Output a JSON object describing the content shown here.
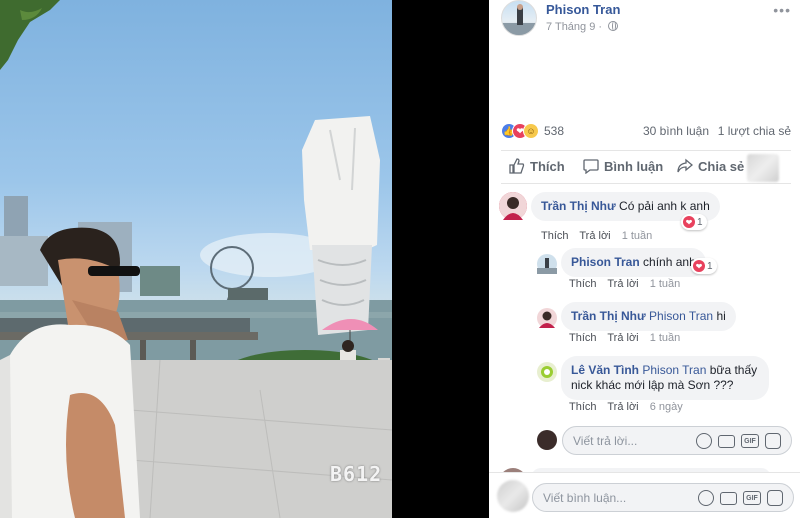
{
  "post": {
    "author": "Phison Tran",
    "date": "7 Tháng 9",
    "reaction_count": "538",
    "comments_count": "30 bình luận",
    "shares_count": "1 lượt chia sẻ",
    "photo_watermark": "B612"
  },
  "actions": {
    "like": "Thích",
    "comment": "Bình luận",
    "share": "Chia sẻ"
  },
  "comments": [
    {
      "name": "Trần Thị Như",
      "text": "Có pải anh k anh",
      "like": "Thích",
      "reply": "Trả lời",
      "time": "1 tuần",
      "reactions": "1"
    },
    {
      "name": "Phison Tran",
      "text": "chính anh",
      "like": "Thích",
      "reply": "Trả lời",
      "time": "1 tuần",
      "reactions": "1"
    },
    {
      "name": "Trần Thị Như",
      "tag": "Phison Tran",
      "text": "hi",
      "like": "Thích",
      "reply": "Trả lời",
      "time": "1 tuần"
    },
    {
      "name": "Lê Văn Tình",
      "tag": "Phison Tran",
      "text": "bữa thấy",
      "text2": "nick khác mới lập mà Sơn ???",
      "like": "Thích",
      "reply": "Trả lời",
      "time": "6 ngày"
    }
  ],
  "reply_box": {
    "placeholder": "Viết trả lời..."
  },
  "comment_box": {
    "placeholder": "Viết bình luận..."
  },
  "colors": {
    "link": "#385898",
    "like_blue": "#4c7ee8",
    "love_red": "#e8415d",
    "haha_yellow": "#f7c94c",
    "bubble": "#f2f3f5"
  },
  "icons": [
    "globe-icon",
    "more-icon",
    "like-icon",
    "comment-icon",
    "share-icon",
    "emoji-icon",
    "camera-icon",
    "gif-icon",
    "sticker-icon",
    "heart-icon"
  ]
}
